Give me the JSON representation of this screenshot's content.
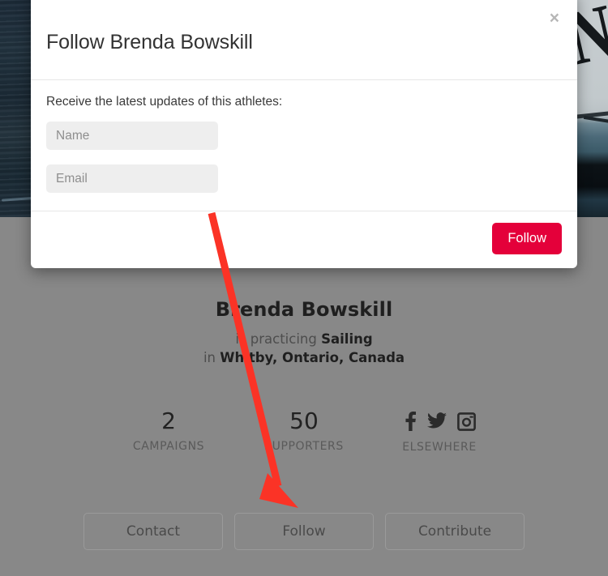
{
  "modal": {
    "title": "Follow Brenda Bowskill",
    "close_label": "×",
    "close_icon": "close-icon",
    "form_label": "Receive the latest updates of this athletes:",
    "fields": [
      {
        "name": "name",
        "placeholder": "Name",
        "value": ""
      },
      {
        "name": "email",
        "placeholder": "Email",
        "value": ""
      }
    ],
    "submit_label": "Follow",
    "submit_color": "#e4003a"
  },
  "profile": {
    "name": "Brenda Bowskill",
    "activity_prefix": "is practicing ",
    "activity": "Sailing",
    "location_prefix": "in ",
    "location": "Whitby, Ontario, Canada"
  },
  "stats": [
    {
      "value": "2",
      "label": "CAMPAIGNS"
    },
    {
      "value": "50",
      "label": "SUPPORTERS"
    }
  ],
  "elsewhere": {
    "label": "ELSEWHERE",
    "icons": [
      "facebook-icon",
      "twitter-icon",
      "instagram-icon"
    ]
  },
  "actions": [
    {
      "label": "Contact"
    },
    {
      "label": "Follow"
    },
    {
      "label": "Contribute"
    }
  ],
  "annotation": {
    "type": "arrow",
    "color": "#fb3326",
    "points_to": "Follow"
  },
  "colors": {
    "overlay": "#888888",
    "accent": "#e4003a",
    "field_bg": "#eeeeee"
  },
  "background": {
    "photo_letter": "N"
  }
}
